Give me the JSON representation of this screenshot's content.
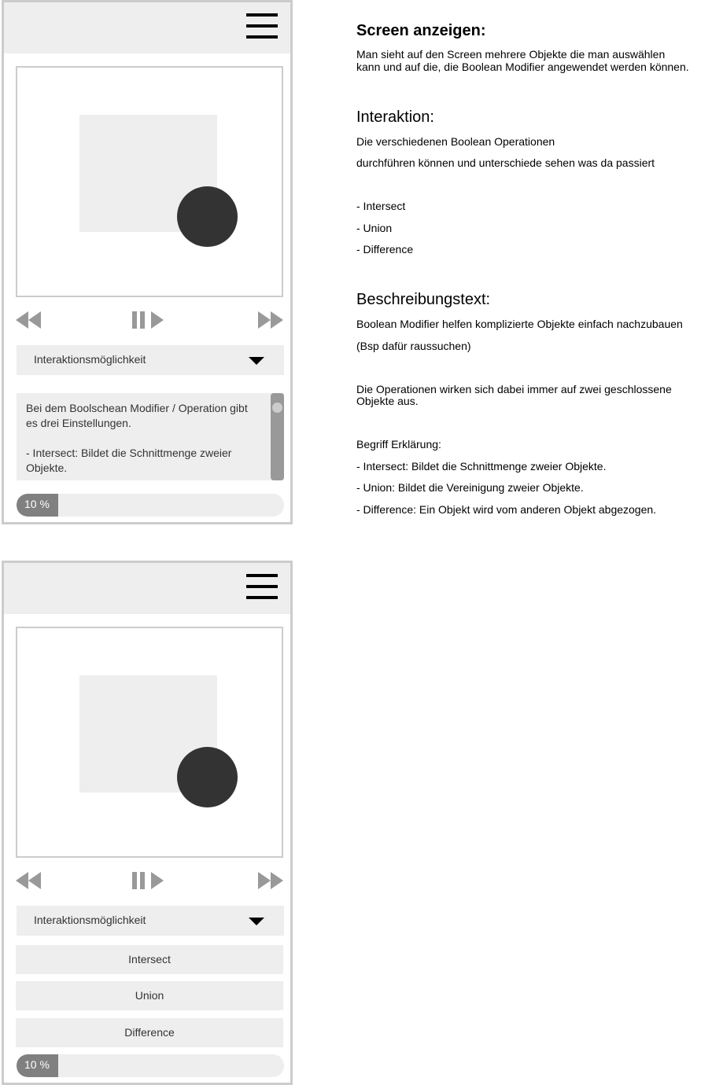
{
  "screen1": {
    "dropdown_label": "Interaktionsmöglichkeit",
    "description": "Bei dem Boolschean Modifier / Operation gibt es drei Einstellungen.\n\n- Intersect: Bildet die Schnittmenge zweier Objekte.",
    "progress_label": "10 %",
    "progress_fraction": 0.1
  },
  "screen2": {
    "dropdown_label": "Interaktionsmöglichkeit",
    "options": [
      "Intersect",
      "Union",
      "Difference"
    ],
    "progress_label": "10 %",
    "progress_fraction": 0.1
  },
  "notes": {
    "section1_title": "Screen anzeigen:",
    "section1_line1": "Man sieht auf den Screen mehrere Objekte die man auswählen",
    "section1_line2": "kann und auf die, die Boolean Modifier angewendet werden können.",
    "section2_title": "Interaktion:",
    "section2_line1": "Die verschiedenen Boolean Operationen",
    "section2_line2": "durchführen können und unterschiede sehen was da passiert",
    "list_intersect": "- Intersect",
    "list_union": "- Union",
    "list_difference": "- Difference",
    "section3_title": "Beschreibungstext:",
    "section3_line1": "Boolean Modifier helfen komplizierte Objekte einfach nachzubauen",
    "section3_line2": "(Bsp dafür raussuchen)",
    "section3_line3": "Die Operationen wirken sich dabei immer auf zwei geschlossene",
    "section3_line4": "Objekte aus.",
    "terms_title": "Begriff Erklärung:",
    "term_intersect": "- Intersect: Bildet die Schnittmenge zweier Objekte.",
    "term_union": "- Union: Bildet die Vereinigung zweier Objekte.",
    "term_difference": "- Difference: Ein Objekt wird vom anderen Objekt abgezogen."
  },
  "icons": {
    "menu": "hamburger-menu-icon",
    "rewind": "rewind-icon",
    "play_pause": "play-pause-icon",
    "forward": "fast-forward-icon",
    "dropdown": "caret-down-icon"
  },
  "colors": {
    "panel_gray": "#eeeeee",
    "sphere": "#333333",
    "control_gray": "#999999",
    "progress_fill": "#808080"
  }
}
